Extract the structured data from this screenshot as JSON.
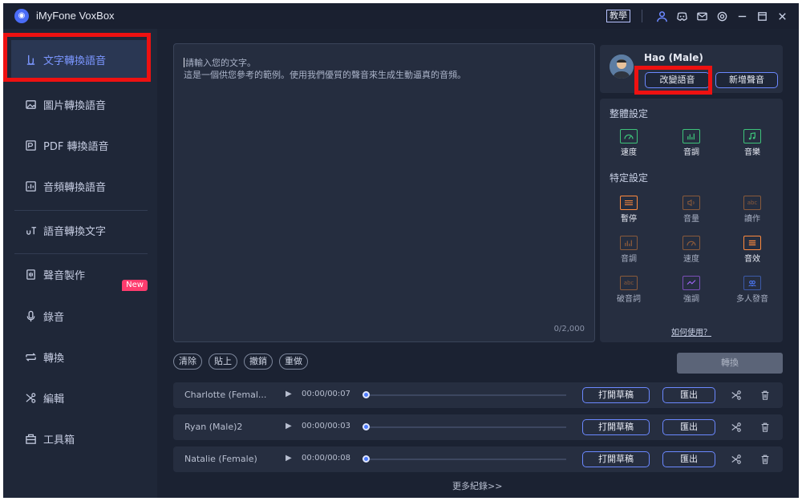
{
  "window": {
    "title": "iMyFone VoxBox",
    "tutorial_label": "教學"
  },
  "sidebar": {
    "items": [
      {
        "label": "文字轉換語音",
        "icon": "text-to-speech-icon",
        "active": true
      },
      {
        "label": "圖片轉換語音",
        "icon": "image-icon"
      },
      {
        "label": "PDF 轉換語音",
        "icon": "pdf-icon"
      },
      {
        "label": "音頻轉換語音",
        "icon": "audio-file-icon"
      },
      {
        "label": "語音轉換文字",
        "icon": "speech-to-text-icon"
      },
      {
        "label": "聲音製作",
        "icon": "voice-clone-icon",
        "badge": "New"
      },
      {
        "label": "錄音",
        "icon": "microphone-icon"
      },
      {
        "label": "轉換",
        "icon": "convert-icon"
      },
      {
        "label": "編輯",
        "icon": "scissors-icon"
      },
      {
        "label": "工具箱",
        "icon": "toolbox-icon"
      }
    ]
  },
  "editor": {
    "line1": "請輸入您的文字。",
    "line2": "這是一個供您參考的範例。使用我們優質的聲音來生成生動逼真的音頻。",
    "counter": "0/2,000"
  },
  "edit_buttons": {
    "clear": "清除",
    "paste": "貼上",
    "undo": "撤銷",
    "redo": "重做"
  },
  "voice": {
    "name": "Hao (Male)",
    "change_voice": "改變語音",
    "add_voice": "新增聲音"
  },
  "settings": {
    "overall_title": "整體設定",
    "specific_title": "特定設定",
    "overall": [
      {
        "label": "速度",
        "icon": "speedometer-icon"
      },
      {
        "label": "音調",
        "icon": "pitch-bars-icon"
      },
      {
        "label": "音樂",
        "icon": "music-note-icon"
      }
    ],
    "specific": [
      {
        "label": "暫停",
        "icon": "pause-icon"
      },
      {
        "label": "音量",
        "icon": "volume-icon"
      },
      {
        "label": "讀作",
        "icon": "read-as-icon"
      },
      {
        "label": "音調",
        "icon": "pitch-bars-icon"
      },
      {
        "label": "速度",
        "icon": "speedometer-icon"
      },
      {
        "label": "音效",
        "icon": "sound-effect-icon"
      },
      {
        "label": "破音詞",
        "icon": "polyphone-icon"
      },
      {
        "label": "強調",
        "icon": "emphasis-icon"
      },
      {
        "label": "多人發音",
        "icon": "multi-speaker-icon"
      }
    ],
    "how_to_use": "如何使用？"
  },
  "convert_label": "轉換",
  "records": [
    {
      "name": "Charlotte (Femal...",
      "time": "00:00/00:07",
      "open_draft": "打開草稿",
      "export": "匯出"
    },
    {
      "name": "Ryan (Male)2",
      "time": "00:00/00:03",
      "open_draft": "打開草稿",
      "export": "匯出"
    },
    {
      "name": "Natalie (Female)",
      "time": "00:00/00:08",
      "open_draft": "打開草稿",
      "export": "匯出"
    }
  ],
  "more_records": "更多紀錄>>",
  "colors": {
    "accent": "#6b88ff",
    "highlight": "#ee1111",
    "badge": "#ff3c6e",
    "green": "#3ec37a",
    "orange": "#ff8a3d",
    "purple": "#a566ff",
    "blue": "#4d7bff"
  }
}
